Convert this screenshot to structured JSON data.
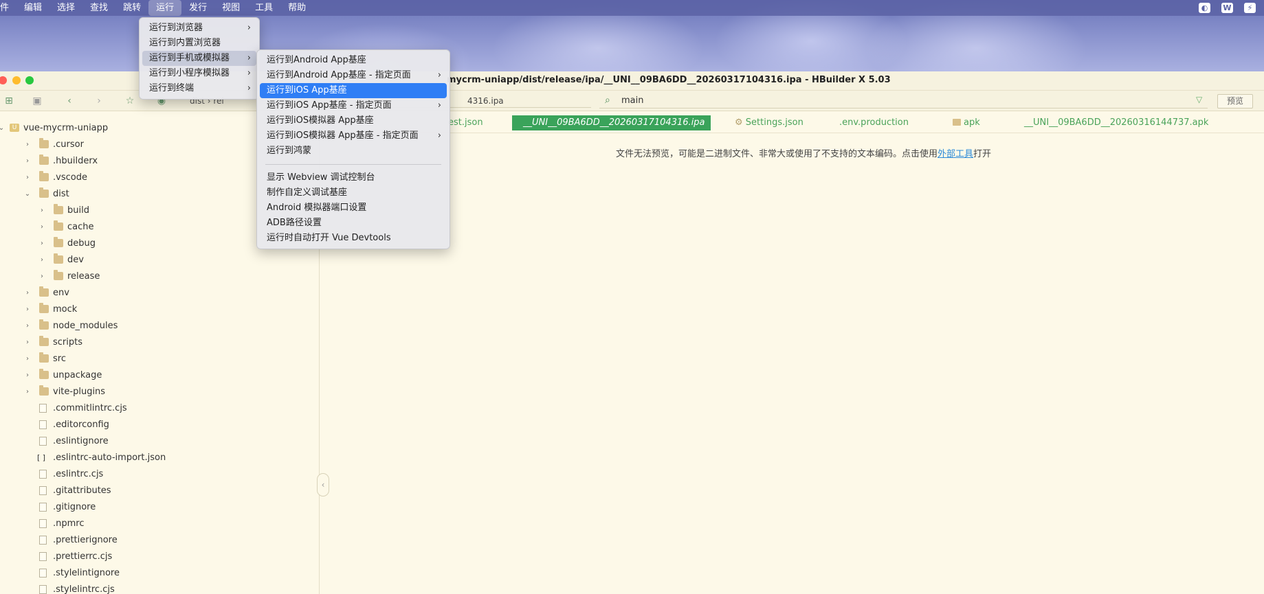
{
  "menubar": {
    "items": [
      "件",
      "编辑",
      "选择",
      "查找",
      "跳转",
      "运行",
      "发行",
      "视图",
      "工具",
      "帮助"
    ],
    "active_index": 5,
    "tray": [
      "◐",
      "W",
      "⚡"
    ]
  },
  "window": {
    "title": "mycrm-uniapp/dist/release/ipa/__UNI__09BA6DD__20260317104316.ipa - HBuilder X 5.03"
  },
  "toolbar": {
    "breadcrumb": [
      "dist",
      "rel"
    ],
    "path_tail": "4316.ipa",
    "search_value": "main",
    "preview_label": "预览"
  },
  "run_menu": {
    "items": [
      {
        "label": "运行到浏览器",
        "submenu": true
      },
      {
        "label": "运行到内置浏览器",
        "submenu": false
      },
      {
        "label": "运行到手机或模拟器",
        "submenu": true
      },
      {
        "label": "运行到小程序模拟器",
        "submenu": true
      },
      {
        "label": "运行到终端",
        "submenu": true
      }
    ],
    "hover_index": 2
  },
  "device_menu": {
    "items": [
      {
        "label": "运行到Android App基座",
        "submenu": false
      },
      {
        "label": "运行到Android App基座 - 指定页面",
        "submenu": true
      },
      {
        "label": "运行到iOS App基座",
        "submenu": false
      },
      {
        "label": "运行到iOS App基座 - 指定页面",
        "submenu": true
      },
      {
        "label": "运行到iOS模拟器 App基座",
        "submenu": false
      },
      {
        "label": "运行到iOS模拟器 App基座 - 指定页面",
        "submenu": true
      },
      {
        "label": "运行到鸿蒙",
        "submenu": false
      },
      {
        "separator": true
      },
      {
        "label": "显示 Webview 调试控制台",
        "submenu": false
      },
      {
        "label": "制作自定义调试基座",
        "submenu": false
      },
      {
        "label": "Android 模拟器端口设置",
        "submenu": false
      },
      {
        "label": "ADB路径设置",
        "submenu": false
      },
      {
        "label": "运行时自动打开 Vue Devtools",
        "submenu": false
      }
    ],
    "selected_index": 2
  },
  "tree": [
    {
      "label": "vue-mycrm-uniapp",
      "type": "project",
      "depth": 0,
      "expanded": true
    },
    {
      "label": ".cursor",
      "type": "folder",
      "depth": 1,
      "expanded": false
    },
    {
      "label": ".hbuilderx",
      "type": "folder",
      "depth": 1,
      "expanded": false
    },
    {
      "label": ".vscode",
      "type": "folder",
      "depth": 1,
      "expanded": false
    },
    {
      "label": "dist",
      "type": "folder",
      "depth": 1,
      "expanded": true
    },
    {
      "label": "build",
      "type": "folder",
      "depth": 2,
      "expanded": false
    },
    {
      "label": "cache",
      "type": "folder",
      "depth": 2,
      "expanded": false
    },
    {
      "label": "debug",
      "type": "folder",
      "depth": 2,
      "expanded": false
    },
    {
      "label": "dev",
      "type": "folder",
      "depth": 2,
      "expanded": false
    },
    {
      "label": "release",
      "type": "folder",
      "depth": 2,
      "expanded": false
    },
    {
      "label": "env",
      "type": "folder",
      "depth": 1,
      "expanded": false
    },
    {
      "label": "mock",
      "type": "folder",
      "depth": 1,
      "expanded": false
    },
    {
      "label": "node_modules",
      "type": "folder",
      "depth": 1,
      "expanded": false
    },
    {
      "label": "scripts",
      "type": "folder",
      "depth": 1,
      "expanded": false
    },
    {
      "label": "src",
      "type": "folder",
      "depth": 1,
      "expanded": false
    },
    {
      "label": "unpackage",
      "type": "folder",
      "depth": 1,
      "expanded": false
    },
    {
      "label": "vite-plugins",
      "type": "folder",
      "depth": 1,
      "expanded": false
    },
    {
      "label": ".commitlintrc.cjs",
      "type": "file",
      "depth": 1
    },
    {
      "label": ".editorconfig",
      "type": "file",
      "depth": 1
    },
    {
      "label": ".eslintignore",
      "type": "file",
      "depth": 1
    },
    {
      "label": ".eslintrc-auto-import.json",
      "type": "json",
      "depth": 1
    },
    {
      "label": ".eslintrc.cjs",
      "type": "file",
      "depth": 1
    },
    {
      "label": ".gitattributes",
      "type": "file",
      "depth": 1
    },
    {
      "label": ".gitignore",
      "type": "file",
      "depth": 1
    },
    {
      "label": ".npmrc",
      "type": "file",
      "depth": 1
    },
    {
      "label": ".prettierignore",
      "type": "file",
      "depth": 1
    },
    {
      "label": ".prettierrc.cjs",
      "type": "file",
      "depth": 1
    },
    {
      "label": ".stylelintignore",
      "type": "file",
      "depth": 1
    },
    {
      "label": ".stylelintrc.cjs",
      "type": "file",
      "depth": 1
    }
  ],
  "tabs": [
    {
      "label": "est.json",
      "active": false
    },
    {
      "label": "__UNI__09BA6DD__20260317104316.ipa",
      "active": true
    },
    {
      "label": "Settings.json",
      "active": false,
      "icon": "gear-icon"
    },
    {
      "label": ".env.production",
      "active": false
    },
    {
      "label": "apk",
      "active": false,
      "icon": "folder-icon"
    },
    {
      "label": "__UNI__09BA6DD__20260316144737.apk",
      "active": false
    }
  ],
  "editor": {
    "message_before": "文件无法预览，可能是二进制文件、非常大或使用了不支持的文本编码。点击使用",
    "message_link": "外部工具",
    "message_after": "打开"
  },
  "colors": {
    "accent_green": "#3aa35a",
    "menu_selected": "#2f7ef5",
    "editor_bg": "#fdf9e8"
  }
}
